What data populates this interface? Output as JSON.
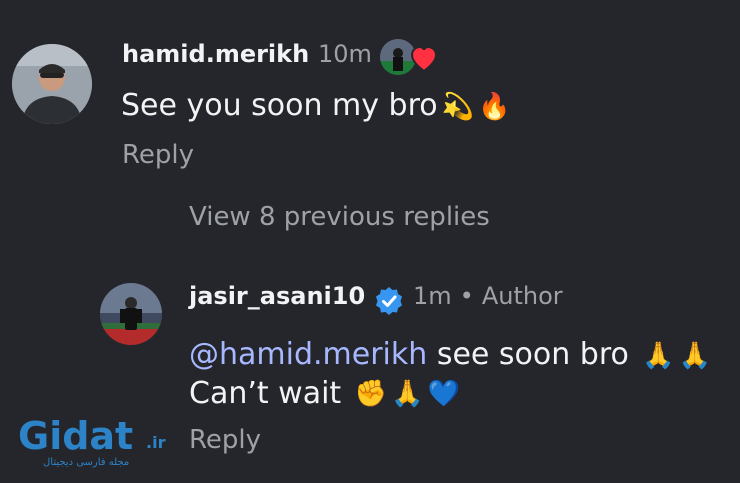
{
  "comment1": {
    "username": "hamid.merikh",
    "time": "10m",
    "text": "See you soon my bro",
    "emojis": [
      "💫",
      "🔥"
    ],
    "reply_label": "Reply",
    "liked_by_author": true
  },
  "thread": {
    "view_previous_label": "View 8 previous replies"
  },
  "comment2": {
    "username": "jasir_asani10",
    "verified": true,
    "time": "1m",
    "separator": "•",
    "author_label": "Author",
    "mention": "@hamid.merikh",
    "text_line1": " see soon  bro",
    "emojis_line1": [
      "🙏",
      "🙏"
    ],
    "text_line2": "Can’t wait",
    "emojis_line2": [
      "✊",
      "🙏",
      "💙"
    ],
    "reply_label": "Reply"
  },
  "watermark": {
    "brand": "Gidat",
    "tld": ".ir",
    "tagline": "مجله فارسی دیجیتال"
  },
  "colors": {
    "background": "#24262b",
    "primary_text": "#f2f3f5",
    "secondary_text": "#9ea1a8",
    "mention": "#a8b8ff",
    "verified_badge": "#3797f0",
    "heart": "#ff3040",
    "watermark": "#2d83c8"
  },
  "icons": {
    "verified": "verified-badge-icon",
    "liked": "heart-icon"
  }
}
